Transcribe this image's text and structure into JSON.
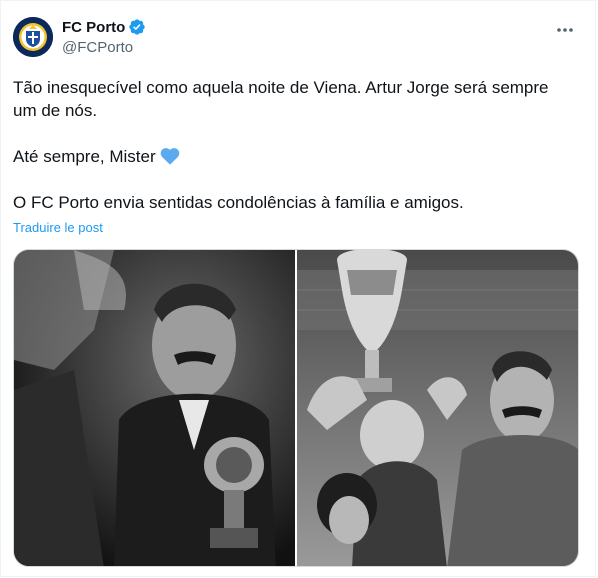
{
  "account": {
    "display_name": "FC Porto",
    "handle": "@FCPorto",
    "verified": true,
    "avatar_icon": "fc-porto-crest-icon"
  },
  "tweet": {
    "line1": "Tão inesquecível como aquela noite de Viena. Artur Jorge será sempre um de nós.",
    "line2": "Até sempre, Mister",
    "line2_emoji": "light-blue-heart-icon",
    "line3": "O FC Porto envia sentidas condolências à família e amigos."
  },
  "translate_label": "Traduire le post",
  "media": [
    {
      "description_icon": "bw-photo-coach-with-trophy"
    },
    {
      "description_icon": "bw-photo-trophy-raised-crowd"
    }
  ],
  "colors": {
    "link": "#1d9bf0",
    "verified_badge": "#1d9bf0",
    "heart": "#5ba9ee",
    "secondary_text": "#536471"
  }
}
